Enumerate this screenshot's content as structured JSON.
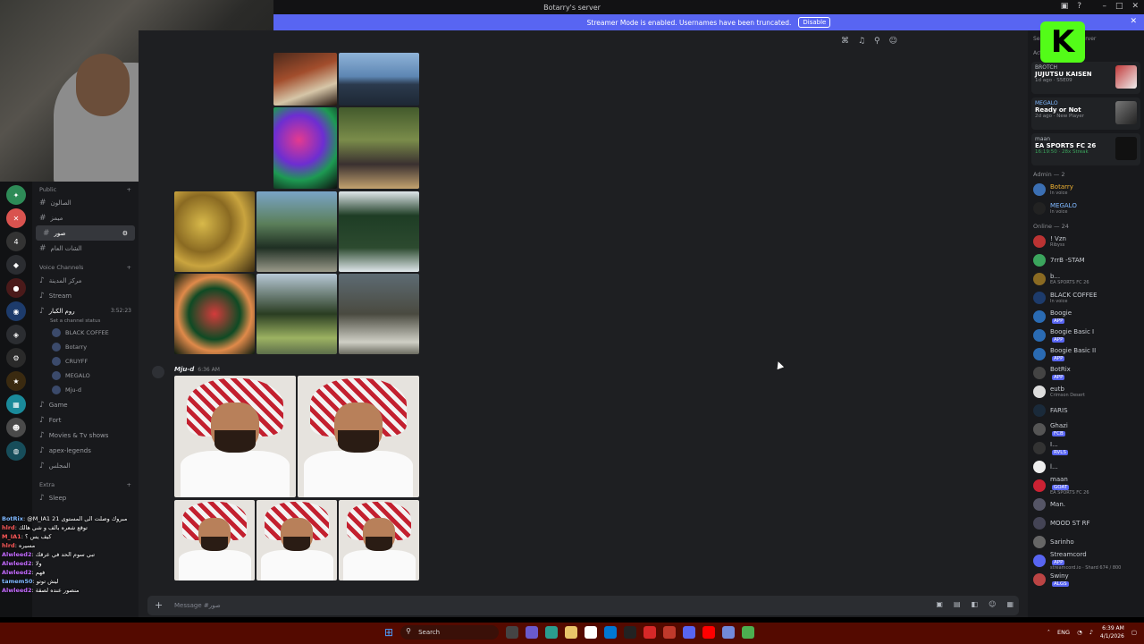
{
  "window": {
    "title": "Botarry's server"
  },
  "banner": {
    "text": "Streamer Mode is enabled. Usernames have been truncated.",
    "disable_label": "Disable"
  },
  "overlay": {
    "kick_letter": "K"
  },
  "channels": {
    "public_section": "Public",
    "text_channels": [
      "الصالون",
      "ميمز",
      "صور",
      "الشات العام"
    ],
    "voice_section": "Voice Channels",
    "voice_channels": [
      "مركز المدينة",
      "Stream",
      "روم الكبار"
    ],
    "voice_timer": "3:52:23",
    "channel_status": "Set a channel status",
    "voice_members": [
      "BLACK COFFEE",
      "Botarry",
      "CRUYFF",
      "MEGALO",
      "Mju-d"
    ],
    "more_channels": [
      "Game",
      "Fort",
      "Movies & Tv shows",
      "apex-legends",
      "المجلس"
    ],
    "extra_section": "Extra",
    "extra_channels": [
      "Sleep"
    ]
  },
  "chat_overlay": [
    {
      "user": "BotRix",
      "text": ": @M_IA1 مبروك وصلت الى المستوى 21"
    },
    {
      "user": "hlrd",
      "text": ": توقع شعره بالف و شي هالك"
    },
    {
      "user": "M_IA1",
      "text": ": كيف يس ؟"
    },
    {
      "user": "hlrd",
      "text": ": مسيره"
    },
    {
      "user": "Alwleed2",
      "text": ": تبي سوم الحد في عرقك"
    },
    {
      "user": "Alwleed2",
      "text": ": ولا"
    },
    {
      "user": "Alwleed2",
      "text": ": فهم"
    },
    {
      "user": "tamem50",
      "text": ": ليش توتو"
    },
    {
      "user": "Alwleed2",
      "text": ": منصور عنده لصقة"
    }
  ],
  "message": {
    "author": "Mju-d",
    "time": "6:36 AM"
  },
  "composer": {
    "placeholder": "Message #صور"
  },
  "members": {
    "search_placeholder": "Search Botarry's server",
    "activity_label": "Activity",
    "activities": [
      {
        "user": "BROTCH",
        "game": "JUJUTSU KAISEN",
        "meta": "1d ago · S5E09"
      },
      {
        "user": "MEGALO",
        "game": "Ready or Not",
        "meta": "2d ago · New Player"
      },
      {
        "user": "maan",
        "game": "EA SPORTS FC 26",
        "meta": "16:19:50 · 28x Streak"
      }
    ],
    "admin_section": "Admin — 2",
    "admins": [
      {
        "name": "Botarry",
        "sub": "In voice"
      },
      {
        "name": "MEGALO",
        "sub": "In voice"
      }
    ],
    "online_section": "Online — 24",
    "online": [
      {
        "name": "! Vzn",
        "sub": "Ribyss",
        "tag": ""
      },
      {
        "name": "7rrB -STAM",
        "sub": "",
        "tag": ""
      },
      {
        "name": "b...",
        "sub": "EA SPORTS FC 26",
        "tag": ""
      },
      {
        "name": "BLACK COFFEE",
        "sub": "In voice",
        "tag": ""
      },
      {
        "name": "Boogie",
        "sub": "",
        "tag": "APP"
      },
      {
        "name": "Boogie Basic I",
        "sub": "",
        "tag": "APP"
      },
      {
        "name": "Boogie Basic II",
        "sub": "",
        "tag": "APP"
      },
      {
        "name": "BotRix",
        "sub": "",
        "tag": "APP"
      },
      {
        "name": "eutb",
        "sub": "Crimson Desert",
        "tag": ""
      },
      {
        "name": "FARIS",
        "sub": "",
        "tag": ""
      },
      {
        "name": "Ghazi",
        "sub": "",
        "tag": "FCB"
      },
      {
        "name": "I...",
        "sub": "",
        "tag": "RVLS"
      },
      {
        "name": "l...",
        "sub": "",
        "tag": ""
      },
      {
        "name": "maan",
        "sub": "EA SPORTS FC 26",
        "tag": "GOAT"
      },
      {
        "name": "Man.",
        "sub": "",
        "tag": ""
      },
      {
        "name": "MOOD ST RF",
        "sub": "",
        "tag": ""
      },
      {
        "name": "Sarinho",
        "sub": "",
        "tag": ""
      },
      {
        "name": "Streamcord",
        "sub": "streamcord.io · Shard 674 / 800",
        "tag": "APP"
      },
      {
        "name": "Swiny",
        "sub": "",
        "tag": "ALGS"
      }
    ]
  },
  "taskbar": {
    "search": "Search",
    "lang": "ENG",
    "time": "6:39 AM",
    "date": "4/1/2026"
  }
}
